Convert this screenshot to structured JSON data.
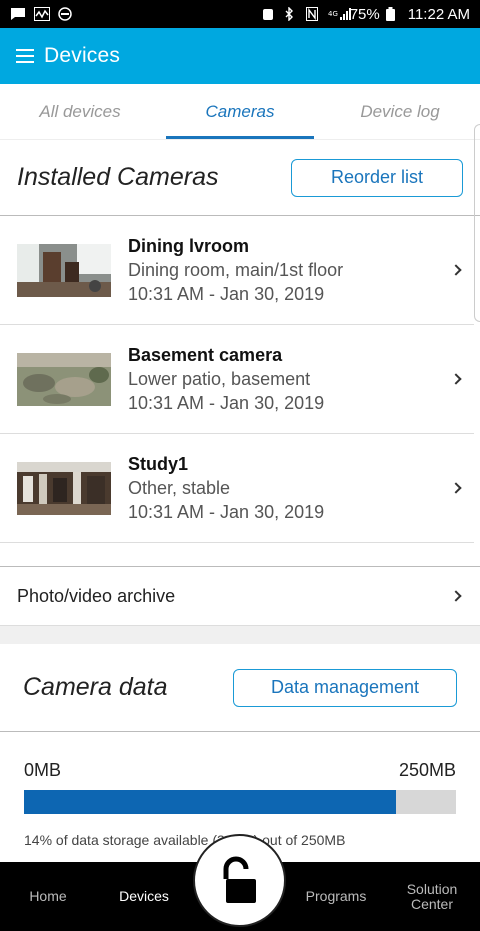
{
  "status_bar": {
    "battery": "75%",
    "time": "11:22 AM"
  },
  "app_bar": {
    "title": "Devices"
  },
  "tabs": [
    {
      "label": "All devices",
      "active": false
    },
    {
      "label": "Cameras",
      "active": true
    },
    {
      "label": "Device log",
      "active": false
    }
  ],
  "installed": {
    "title": "Installed Cameras",
    "reorder_label": "Reorder list"
  },
  "cameras": [
    {
      "name": "Dining lvroom",
      "location": "Dining room, main/1st floor",
      "time": "10:31 AM - Jan 30, 2019"
    },
    {
      "name": "Basement camera",
      "location": "Lower patio, basement",
      "time": "10:31 AM - Jan 30, 2019"
    },
    {
      "name": "Study1",
      "location": "Other, stable",
      "time": "10:31 AM - Jan 30, 2019"
    }
  ],
  "archive": {
    "label": "Photo/video archive"
  },
  "camera_data": {
    "title": "Camera data",
    "manage_label": "Data management",
    "min_label": "0MB",
    "max_label": "250MB",
    "used_fraction": 0.86,
    "note": "14% of data storage available (36MB) out of 250MB"
  },
  "bottom_nav": {
    "home": "Home",
    "devices": "Devices",
    "programs": "Programs",
    "solution": "Solution Center"
  },
  "colors": {
    "brand": "#00a8e0",
    "accent": "#1a75bc",
    "bar": "#0d66b2"
  }
}
